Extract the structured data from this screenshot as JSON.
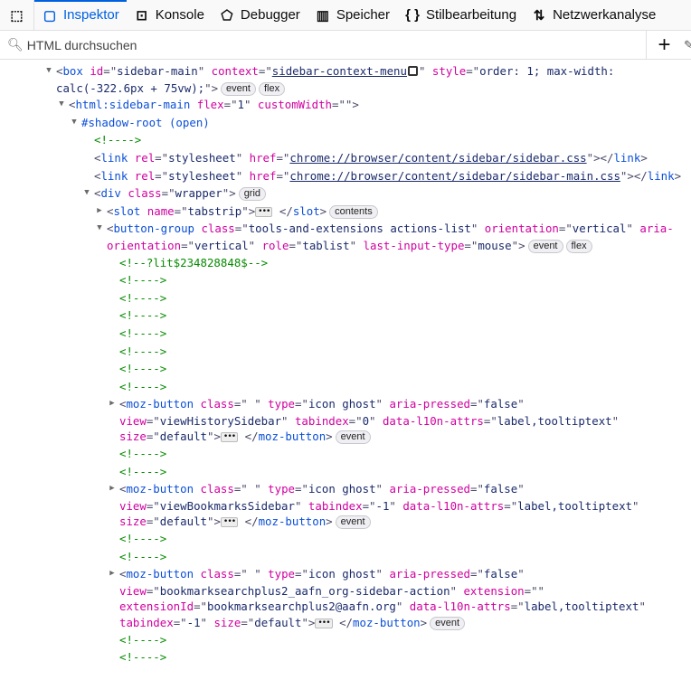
{
  "toolbar": {
    "tabs": [
      {
        "label": "Inspektor",
        "icon": "inspector-icon",
        "glyph": "▢",
        "active": true
      },
      {
        "label": "Konsole",
        "icon": "console-icon",
        "glyph": "⊡"
      },
      {
        "label": "Debugger",
        "icon": "debugger-icon",
        "glyph": "⬠"
      },
      {
        "label": "Speicher",
        "icon": "memory-icon",
        "glyph": "▥"
      },
      {
        "label": "Stilbearbeitung",
        "icon": "style-editor-icon",
        "glyph": "{ }"
      },
      {
        "label": "Netzwerkanalyse",
        "icon": "network-icon",
        "glyph": "⇅"
      }
    ]
  },
  "search": {
    "placeholder": "HTML durchsuchen"
  },
  "tree": [
    {
      "lvl": 0,
      "tw": "open",
      "t": [
        [
          "p",
          "<"
        ],
        [
          "tag",
          "box"
        ],
        [
          "an",
          " id"
        ],
        [
          "p",
          "=\""
        ],
        [
          "av",
          "sidebar-main"
        ],
        [
          "p",
          "\""
        ],
        [
          "an",
          " context"
        ],
        [
          "p",
          "=\""
        ],
        [
          "lk",
          "sidebar-context-menu"
        ],
        [
          "chip",
          ""
        ],
        [
          "p",
          "\""
        ],
        [
          "an",
          " style"
        ],
        [
          "p",
          "=\""
        ],
        [
          "av",
          "order: 1; max-width:"
        ]
      ]
    },
    {
      "lvl": 0,
      "w": 1,
      "t": [
        [
          "av",
          "calc(-322.6px + 75vw);"
        ],
        [
          "p",
          "\">"
        ]
      ],
      "b": [
        "event",
        "flex"
      ]
    },
    {
      "lvl": 1,
      "tw": "open",
      "t": [
        [
          "p",
          "<"
        ],
        [
          "tag",
          "html:sidebar-main"
        ],
        [
          "an",
          " flex"
        ],
        [
          "p",
          "=\""
        ],
        [
          "av",
          "1"
        ],
        [
          "p",
          "\""
        ],
        [
          "an",
          " customWidth"
        ],
        [
          "p",
          "=\"\">"
        ]
      ]
    },
    {
      "lvl": 2,
      "tw": "open",
      "t": [
        [
          "tag",
          "#shadow-root (open)"
        ]
      ]
    },
    {
      "lvl": 3,
      "t": [
        [
          "cm",
          "<!---->"
        ]
      ]
    },
    {
      "lvl": 3,
      "t": [
        [
          "p",
          "<"
        ],
        [
          "tag",
          "link"
        ],
        [
          "an",
          " rel"
        ],
        [
          "p",
          "=\""
        ],
        [
          "av",
          "stylesheet"
        ],
        [
          "p",
          "\""
        ],
        [
          "an",
          " href"
        ],
        [
          "p",
          "=\""
        ],
        [
          "lk",
          "chrome://browser/content/sidebar/sidebar.css"
        ],
        [
          "p",
          "\"></"
        ],
        [
          "tag",
          "link"
        ],
        [
          "p",
          ">"
        ]
      ]
    },
    {
      "lvl": 3,
      "t": [
        [
          "p",
          "<"
        ],
        [
          "tag",
          "link"
        ],
        [
          "an",
          " rel"
        ],
        [
          "p",
          "=\""
        ],
        [
          "av",
          "stylesheet"
        ],
        [
          "p",
          "\""
        ],
        [
          "an",
          " href"
        ],
        [
          "p",
          "=\""
        ],
        [
          "lk",
          "chrome://browser/content/sidebar/sidebar-main.css"
        ],
        [
          "p",
          "\"></"
        ],
        [
          "tag",
          "link"
        ],
        [
          "p",
          ">"
        ]
      ]
    },
    {
      "lvl": 3,
      "tw": "open",
      "t": [
        [
          "p",
          "<"
        ],
        [
          "tag",
          "div"
        ],
        [
          "an",
          " class"
        ],
        [
          "p",
          "=\""
        ],
        [
          "av",
          "wrapper"
        ],
        [
          "p",
          "\">"
        ]
      ],
      "b": [
        "grid"
      ]
    },
    {
      "lvl": 4,
      "tw": "closed",
      "t": [
        [
          "p",
          "<"
        ],
        [
          "tag",
          "slot"
        ],
        [
          "an",
          " name"
        ],
        [
          "p",
          "=\""
        ],
        [
          "av",
          "tabstrip"
        ],
        [
          "p",
          "\">"
        ],
        [
          "more",
          "•••"
        ],
        [
          "p",
          " </"
        ],
        [
          "tag",
          "slot"
        ],
        [
          "p",
          ">"
        ]
      ],
      "b": [
        "contents"
      ]
    },
    {
      "lvl": 4,
      "tw": "open",
      "t": [
        [
          "p",
          "<"
        ],
        [
          "tag",
          "button-group"
        ],
        [
          "an",
          " class"
        ],
        [
          "p",
          "=\""
        ],
        [
          "av",
          "tools-and-extensions actions-list"
        ],
        [
          "p",
          "\""
        ],
        [
          "an",
          " orientation"
        ],
        [
          "p",
          "=\""
        ],
        [
          "av",
          "vertical"
        ],
        [
          "p",
          "\""
        ],
        [
          "an",
          " aria-"
        ]
      ]
    },
    {
      "lvl": 4,
      "w": 1,
      "t": [
        [
          "an",
          "orientation"
        ],
        [
          "p",
          "=\""
        ],
        [
          "av",
          "vertical"
        ],
        [
          "p",
          "\""
        ],
        [
          "an",
          " role"
        ],
        [
          "p",
          "=\""
        ],
        [
          "av",
          "tablist"
        ],
        [
          "p",
          "\""
        ],
        [
          "an",
          " last-input-type"
        ],
        [
          "p",
          "=\""
        ],
        [
          "av",
          "mouse"
        ],
        [
          "p",
          "\">"
        ]
      ],
      "b": [
        "event",
        "flex"
      ]
    },
    {
      "lvl": 5,
      "t": [
        [
          "cm",
          "<!--?lit$234828848$-->"
        ]
      ]
    },
    {
      "lvl": 5,
      "t": [
        [
          "cm",
          "<!---->"
        ]
      ]
    },
    {
      "lvl": 5,
      "t": [
        [
          "cm",
          "<!---->"
        ]
      ]
    },
    {
      "lvl": 5,
      "t": [
        [
          "cm",
          "<!---->"
        ]
      ]
    },
    {
      "lvl": 5,
      "t": [
        [
          "cm",
          "<!---->"
        ]
      ]
    },
    {
      "lvl": 5,
      "t": [
        [
          "cm",
          "<!---->"
        ]
      ]
    },
    {
      "lvl": 5,
      "t": [
        [
          "cm",
          "<!---->"
        ]
      ]
    },
    {
      "lvl": 5,
      "t": [
        [
          "cm",
          "<!---->"
        ]
      ]
    },
    {
      "lvl": 5,
      "tw": "closed",
      "t": [
        [
          "p",
          "<"
        ],
        [
          "tag",
          "moz-button"
        ],
        [
          "an",
          " class"
        ],
        [
          "p",
          "=\""
        ],
        [
          "av",
          " "
        ],
        [
          "p",
          "\""
        ],
        [
          "an",
          " type"
        ],
        [
          "p",
          "=\""
        ],
        [
          "av",
          "icon ghost"
        ],
        [
          "p",
          "\""
        ],
        [
          "an",
          " aria-pressed"
        ],
        [
          "p",
          "=\""
        ],
        [
          "av",
          "false"
        ],
        [
          "p",
          "\""
        ]
      ]
    },
    {
      "lvl": 5,
      "w": 1,
      "t": [
        [
          "an",
          "view"
        ],
        [
          "p",
          "=\""
        ],
        [
          "av",
          "viewHistorySidebar"
        ],
        [
          "p",
          "\""
        ],
        [
          "an",
          " tabindex"
        ],
        [
          "p",
          "=\""
        ],
        [
          "av",
          "0"
        ],
        [
          "p",
          "\""
        ],
        [
          "an",
          " data-l10n-attrs"
        ],
        [
          "p",
          "=\""
        ],
        [
          "av",
          "label,tooltiptext"
        ],
        [
          "p",
          "\""
        ]
      ]
    },
    {
      "lvl": 5,
      "w": 1,
      "t": [
        [
          "an",
          "size"
        ],
        [
          "p",
          "=\""
        ],
        [
          "av",
          "default"
        ],
        [
          "p",
          "\">"
        ],
        [
          "more",
          "•••"
        ],
        [
          "p",
          " </"
        ],
        [
          "tag",
          "moz-button"
        ],
        [
          "p",
          ">"
        ]
      ],
      "b": [
        "event"
      ]
    },
    {
      "lvl": 5,
      "t": [
        [
          "cm",
          "<!---->"
        ]
      ]
    },
    {
      "lvl": 5,
      "t": [
        [
          "cm",
          "<!---->"
        ]
      ]
    },
    {
      "lvl": 5,
      "tw": "closed",
      "t": [
        [
          "p",
          "<"
        ],
        [
          "tag",
          "moz-button"
        ],
        [
          "an",
          " class"
        ],
        [
          "p",
          "=\""
        ],
        [
          "av",
          " "
        ],
        [
          "p",
          "\""
        ],
        [
          "an",
          " type"
        ],
        [
          "p",
          "=\""
        ],
        [
          "av",
          "icon ghost"
        ],
        [
          "p",
          "\""
        ],
        [
          "an",
          " aria-pressed"
        ],
        [
          "p",
          "=\""
        ],
        [
          "av",
          "false"
        ],
        [
          "p",
          "\""
        ]
      ]
    },
    {
      "lvl": 5,
      "w": 1,
      "t": [
        [
          "an",
          "view"
        ],
        [
          "p",
          "=\""
        ],
        [
          "av",
          "viewBookmarksSidebar"
        ],
        [
          "p",
          "\""
        ],
        [
          "an",
          " tabindex"
        ],
        [
          "p",
          "=\""
        ],
        [
          "av",
          "-1"
        ],
        [
          "p",
          "\""
        ],
        [
          "an",
          " data-l10n-attrs"
        ],
        [
          "p",
          "=\""
        ],
        [
          "av",
          "label,tooltiptext"
        ],
        [
          "p",
          "\""
        ]
      ]
    },
    {
      "lvl": 5,
      "w": 1,
      "t": [
        [
          "an",
          "size"
        ],
        [
          "p",
          "=\""
        ],
        [
          "av",
          "default"
        ],
        [
          "p",
          "\">"
        ],
        [
          "more",
          "•••"
        ],
        [
          "p",
          " </"
        ],
        [
          "tag",
          "moz-button"
        ],
        [
          "p",
          ">"
        ]
      ],
      "b": [
        "event"
      ]
    },
    {
      "lvl": 5,
      "t": [
        [
          "cm",
          "<!---->"
        ]
      ]
    },
    {
      "lvl": 5,
      "t": [
        [
          "cm",
          "<!---->"
        ]
      ]
    },
    {
      "lvl": 5,
      "tw": "closed",
      "t": [
        [
          "p",
          "<"
        ],
        [
          "tag",
          "moz-button"
        ],
        [
          "an",
          " class"
        ],
        [
          "p",
          "=\""
        ],
        [
          "av",
          " "
        ],
        [
          "p",
          "\""
        ],
        [
          "an",
          " type"
        ],
        [
          "p",
          "=\""
        ],
        [
          "av",
          "icon ghost"
        ],
        [
          "p",
          "\""
        ],
        [
          "an",
          " aria-pressed"
        ],
        [
          "p",
          "=\""
        ],
        [
          "av",
          "false"
        ],
        [
          "p",
          "\""
        ]
      ]
    },
    {
      "lvl": 5,
      "w": 1,
      "t": [
        [
          "an",
          "view"
        ],
        [
          "p",
          "=\""
        ],
        [
          "av",
          "bookmarksearchplus2_aafn_org-sidebar-action"
        ],
        [
          "p",
          "\""
        ],
        [
          "an",
          " extension"
        ],
        [
          "p",
          "=\"\""
        ]
      ]
    },
    {
      "lvl": 5,
      "w": 1,
      "t": [
        [
          "an",
          "extensionId"
        ],
        [
          "p",
          "=\""
        ],
        [
          "av",
          "bookmarksearchplus2@aafn.org"
        ],
        [
          "p",
          "\""
        ],
        [
          "an",
          " data-l10n-attrs"
        ],
        [
          "p",
          "=\""
        ],
        [
          "av",
          "label,tooltiptext"
        ],
        [
          "p",
          "\""
        ]
      ]
    },
    {
      "lvl": 5,
      "w": 1,
      "t": [
        [
          "an",
          "tabindex"
        ],
        [
          "p",
          "=\""
        ],
        [
          "av",
          "-1"
        ],
        [
          "p",
          "\""
        ],
        [
          "an",
          " size"
        ],
        [
          "p",
          "=\""
        ],
        [
          "av",
          "default"
        ],
        [
          "p",
          "\">"
        ],
        [
          "more",
          "•••"
        ],
        [
          "p",
          " </"
        ],
        [
          "tag",
          "moz-button"
        ],
        [
          "p",
          ">"
        ]
      ],
      "b": [
        "event"
      ]
    },
    {
      "lvl": 5,
      "t": [
        [
          "cm",
          "<!---->"
        ]
      ]
    },
    {
      "lvl": 5,
      "t": [
        [
          "cm",
          "<!---->"
        ]
      ]
    }
  ]
}
